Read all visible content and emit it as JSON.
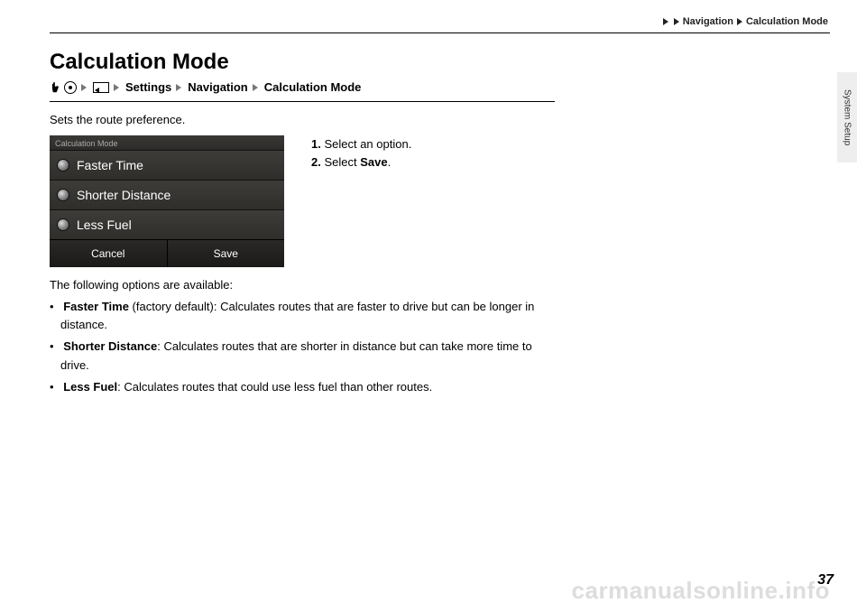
{
  "header": {
    "crumb1": "Navigation",
    "crumb2": "Calculation Mode"
  },
  "sideTab": "System Setup",
  "title": "Calculation Mode",
  "navPath": {
    "settings": "Settings",
    "navigation": "Navigation",
    "calcMode": "Calculation Mode"
  },
  "desc": "Sets the route preference.",
  "screenshot": {
    "header": "Calculation Mode",
    "opt1": "Faster Time",
    "opt2": "Shorter Distance",
    "opt3": "Less Fuel",
    "cancel": "Cancel",
    "save": "Save"
  },
  "steps": {
    "s1n": "1.",
    "s1t": " Select an option.",
    "s2n": "2.",
    "s2t": " Select ",
    "s2b": "Save",
    "s2d": "."
  },
  "optionsIntro": "The following options are available:",
  "options": {
    "o1b": "Faster Time",
    "o1t": " (factory default): Calculates routes that are faster to drive but can be longer in distance.",
    "o2b": "Shorter Distance",
    "o2t": ": Calculates routes that are shorter in distance but can take more time to drive.",
    "o3b": "Less Fuel",
    "o3t": ": Calculates routes that could use less fuel than other routes."
  },
  "pageNumber": "37",
  "watermark": "carmanualsonline.info"
}
